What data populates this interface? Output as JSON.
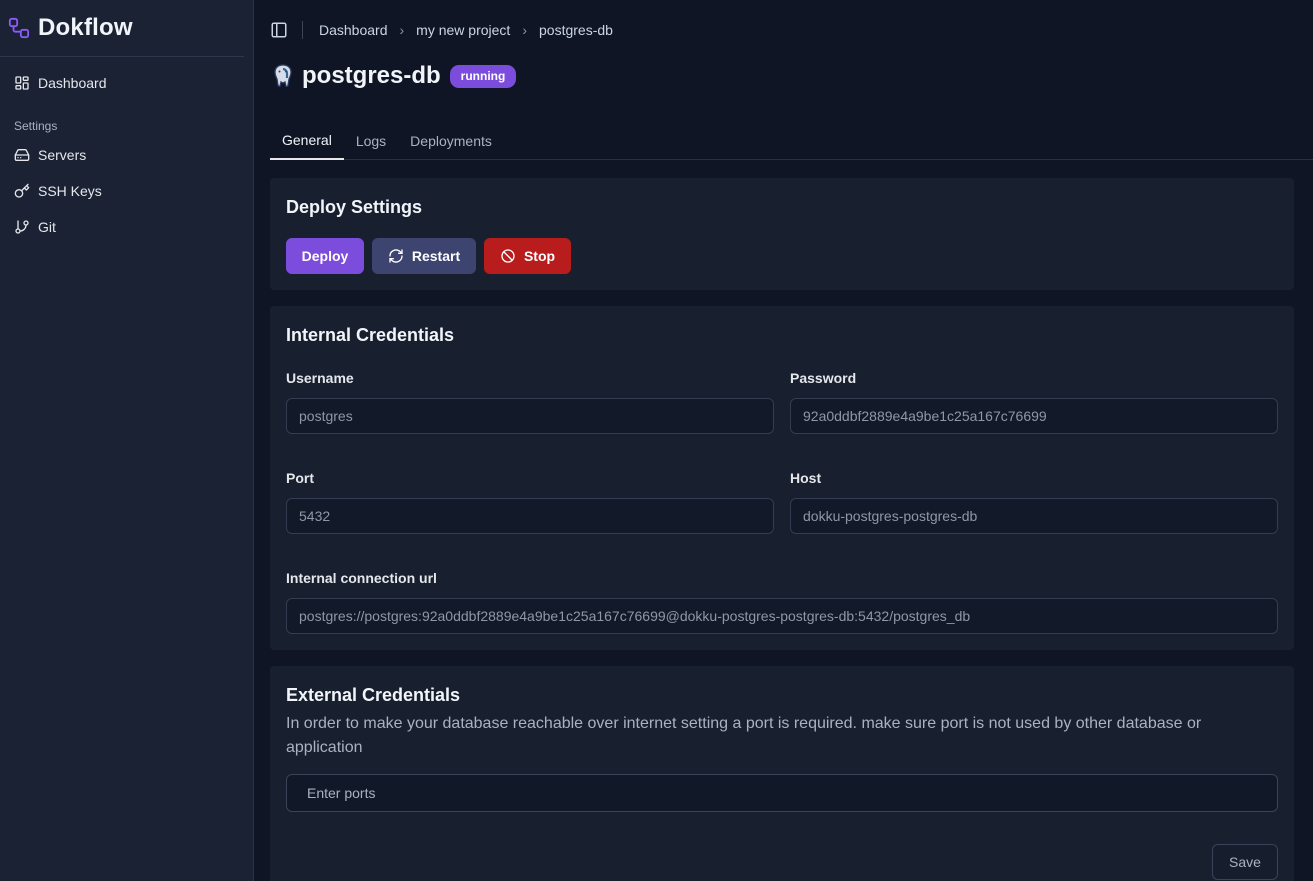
{
  "brand": {
    "name": "Dokflow",
    "icon": "workflow-icon"
  },
  "sidebar": {
    "items": [
      {
        "label": "Dashboard",
        "icon": "dashboard-icon"
      }
    ],
    "section_label": "Settings",
    "settings_items": [
      {
        "label": "Servers",
        "icon": "server-icon"
      },
      {
        "label": "SSH Keys",
        "icon": "key-icon"
      },
      {
        "label": "Git",
        "icon": "git-branch-icon"
      }
    ]
  },
  "breadcrumb": [
    "Dashboard",
    "my new project",
    "postgres-db"
  ],
  "page": {
    "title": "postgres-db",
    "status": "running",
    "icon": "postgres-elephant-icon"
  },
  "tabs": [
    "General",
    "Logs",
    "Deployments"
  ],
  "deploy": {
    "heading": "Deploy Settings",
    "deploy_label": "Deploy",
    "restart_label": "Restart",
    "stop_label": "Stop"
  },
  "internal": {
    "heading": "Internal Credentials",
    "username_label": "Username",
    "username_value": "postgres",
    "password_label": "Password",
    "password_value": "92a0ddbf2889e4a9be1c25a167c76699",
    "port_label": "Port",
    "port_value": "5432",
    "host_label": "Host",
    "host_value": "dokku-postgres-postgres-db",
    "url_label": "Internal connection url",
    "url_value": "postgres://postgres:92a0ddbf2889e4a9be1c25a167c76699@dokku-postgres-postgres-db:5432/postgres_db"
  },
  "external": {
    "heading": "External Credentials",
    "description": "In order to make your database reachable over internet setting a port is required. make sure port is not used by other database or application",
    "ports_placeholder": "Enter ports",
    "save_label": "Save"
  },
  "colors": {
    "accent": "#7c4ddc",
    "restart": "#3d4470",
    "stop": "#b91c1c",
    "background": "#0f1524",
    "sidebar": "#1a2234",
    "card": "#18202f"
  }
}
